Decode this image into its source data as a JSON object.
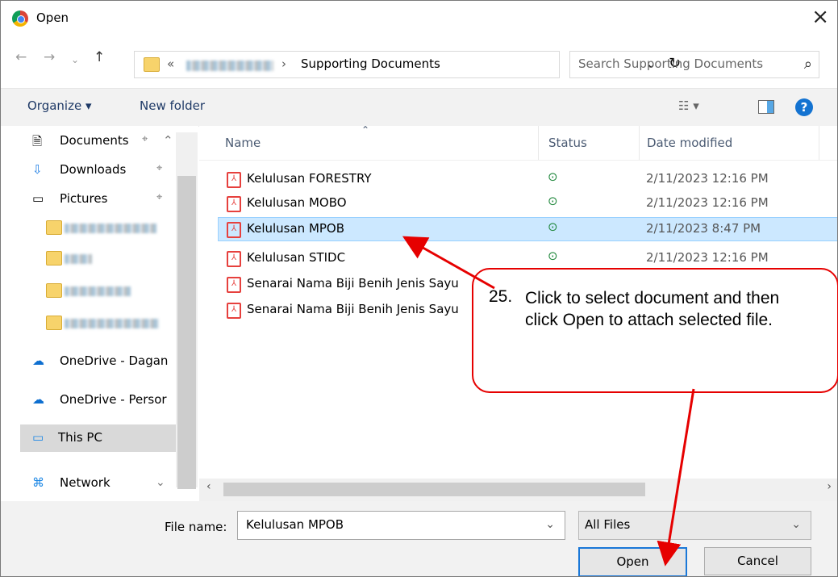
{
  "dialog": {
    "title": "Open",
    "close_symbol": "×"
  },
  "address": {
    "prefix": "«",
    "folder": "Supporting Documents",
    "dropdown": "⌄",
    "refresh": "↻"
  },
  "search": {
    "placeholder": "Search Supporting Documents",
    "icon": "search-icon"
  },
  "toolbar": {
    "organize_label": "Organize ▾",
    "new_folder_label": "New folder",
    "help": "?"
  },
  "sidebar": {
    "items": [
      {
        "label": "Documents"
      },
      {
        "label": "Downloads"
      },
      {
        "label": "Pictures"
      },
      {
        "label": ""
      },
      {
        "label": ""
      },
      {
        "label": ""
      },
      {
        "label": ""
      },
      {
        "label": "OneDrive - Dagan"
      },
      {
        "label": "OneDrive - Persor"
      },
      {
        "label": "This PC"
      },
      {
        "label": "Network"
      }
    ]
  },
  "columns": {
    "name": "Name",
    "status": "Status",
    "date_modified": "Date modified"
  },
  "files": [
    {
      "name": "Kelulusan FORESTRY",
      "date": "2/11/2023 12:16 PM"
    },
    {
      "name": "Kelulusan MOBO",
      "date": "2/11/2023 12:16 PM"
    },
    {
      "name": "Kelulusan MPOB",
      "date": "2/11/2023 8:47 PM"
    },
    {
      "name": "Kelulusan STIDC",
      "date": "2/11/2023 12:16 PM"
    },
    {
      "name": "Senarai Nama Biji Benih Jenis Sayu",
      "date": ""
    },
    {
      "name": "Senarai Nama Biji Benih Jenis Sayu",
      "date": ""
    }
  ],
  "status_mark": "⊙",
  "bottom": {
    "file_name_label": "File name:",
    "file_name_value": "Kelulusan MPOB",
    "filter_value": "All Files",
    "open_label": "Open",
    "cancel_label": "Cancel"
  },
  "annotation": {
    "step": "25.",
    "text": "Click to select document and then click Open to attach selected file."
  },
  "colors": {
    "accent": "#1b78d8",
    "selection": "#cce8ff",
    "annotation": "#e60000",
    "status": "#21883d"
  }
}
